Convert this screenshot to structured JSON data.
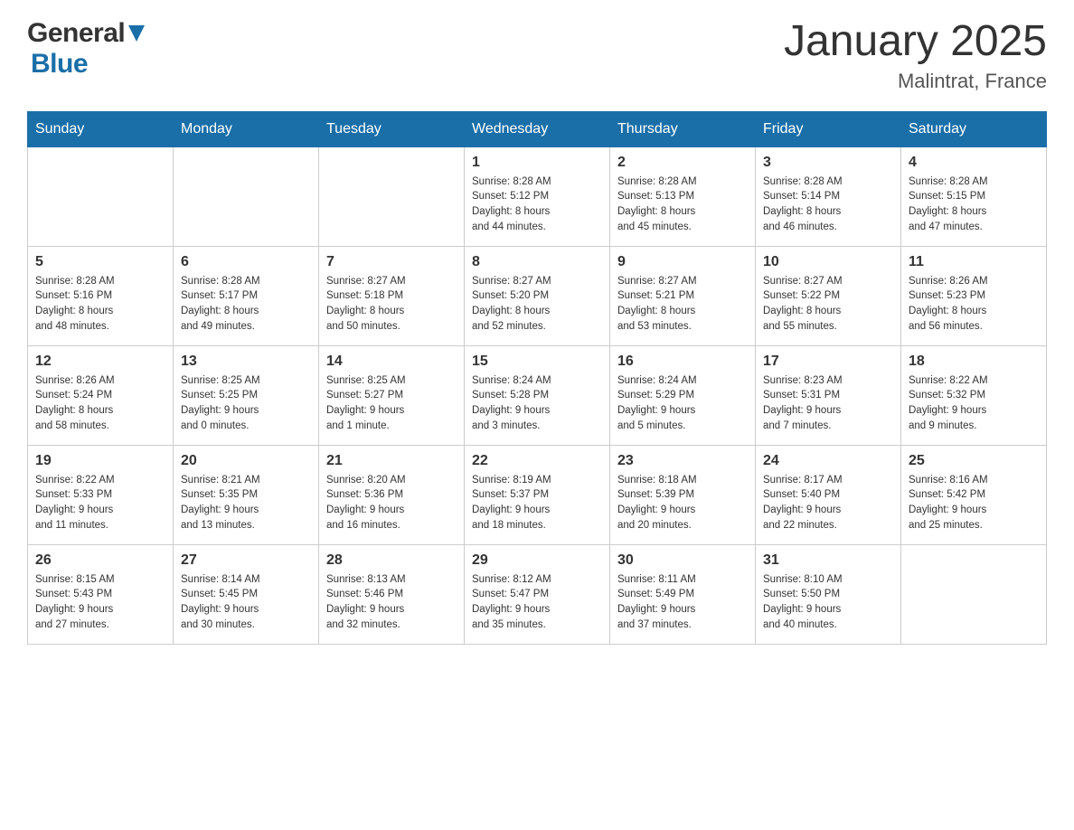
{
  "header": {
    "logo_general": "General",
    "logo_blue": "Blue",
    "title": "January 2025",
    "subtitle": "Malintrat, France"
  },
  "days_of_week": [
    "Sunday",
    "Monday",
    "Tuesday",
    "Wednesday",
    "Thursday",
    "Friday",
    "Saturday"
  ],
  "weeks": [
    [
      {
        "day": "",
        "info": ""
      },
      {
        "day": "",
        "info": ""
      },
      {
        "day": "",
        "info": ""
      },
      {
        "day": "1",
        "info": "Sunrise: 8:28 AM\nSunset: 5:12 PM\nDaylight: 8 hours\nand 44 minutes."
      },
      {
        "day": "2",
        "info": "Sunrise: 8:28 AM\nSunset: 5:13 PM\nDaylight: 8 hours\nand 45 minutes."
      },
      {
        "day": "3",
        "info": "Sunrise: 8:28 AM\nSunset: 5:14 PM\nDaylight: 8 hours\nand 46 minutes."
      },
      {
        "day": "4",
        "info": "Sunrise: 8:28 AM\nSunset: 5:15 PM\nDaylight: 8 hours\nand 47 minutes."
      }
    ],
    [
      {
        "day": "5",
        "info": "Sunrise: 8:28 AM\nSunset: 5:16 PM\nDaylight: 8 hours\nand 48 minutes."
      },
      {
        "day": "6",
        "info": "Sunrise: 8:28 AM\nSunset: 5:17 PM\nDaylight: 8 hours\nand 49 minutes."
      },
      {
        "day": "7",
        "info": "Sunrise: 8:27 AM\nSunset: 5:18 PM\nDaylight: 8 hours\nand 50 minutes."
      },
      {
        "day": "8",
        "info": "Sunrise: 8:27 AM\nSunset: 5:20 PM\nDaylight: 8 hours\nand 52 minutes."
      },
      {
        "day": "9",
        "info": "Sunrise: 8:27 AM\nSunset: 5:21 PM\nDaylight: 8 hours\nand 53 minutes."
      },
      {
        "day": "10",
        "info": "Sunrise: 8:27 AM\nSunset: 5:22 PM\nDaylight: 8 hours\nand 55 minutes."
      },
      {
        "day": "11",
        "info": "Sunrise: 8:26 AM\nSunset: 5:23 PM\nDaylight: 8 hours\nand 56 minutes."
      }
    ],
    [
      {
        "day": "12",
        "info": "Sunrise: 8:26 AM\nSunset: 5:24 PM\nDaylight: 8 hours\nand 58 minutes."
      },
      {
        "day": "13",
        "info": "Sunrise: 8:25 AM\nSunset: 5:25 PM\nDaylight: 9 hours\nand 0 minutes."
      },
      {
        "day": "14",
        "info": "Sunrise: 8:25 AM\nSunset: 5:27 PM\nDaylight: 9 hours\nand 1 minute."
      },
      {
        "day": "15",
        "info": "Sunrise: 8:24 AM\nSunset: 5:28 PM\nDaylight: 9 hours\nand 3 minutes."
      },
      {
        "day": "16",
        "info": "Sunrise: 8:24 AM\nSunset: 5:29 PM\nDaylight: 9 hours\nand 5 minutes."
      },
      {
        "day": "17",
        "info": "Sunrise: 8:23 AM\nSunset: 5:31 PM\nDaylight: 9 hours\nand 7 minutes."
      },
      {
        "day": "18",
        "info": "Sunrise: 8:22 AM\nSunset: 5:32 PM\nDaylight: 9 hours\nand 9 minutes."
      }
    ],
    [
      {
        "day": "19",
        "info": "Sunrise: 8:22 AM\nSunset: 5:33 PM\nDaylight: 9 hours\nand 11 minutes."
      },
      {
        "day": "20",
        "info": "Sunrise: 8:21 AM\nSunset: 5:35 PM\nDaylight: 9 hours\nand 13 minutes."
      },
      {
        "day": "21",
        "info": "Sunrise: 8:20 AM\nSunset: 5:36 PM\nDaylight: 9 hours\nand 16 minutes."
      },
      {
        "day": "22",
        "info": "Sunrise: 8:19 AM\nSunset: 5:37 PM\nDaylight: 9 hours\nand 18 minutes."
      },
      {
        "day": "23",
        "info": "Sunrise: 8:18 AM\nSunset: 5:39 PM\nDaylight: 9 hours\nand 20 minutes."
      },
      {
        "day": "24",
        "info": "Sunrise: 8:17 AM\nSunset: 5:40 PM\nDaylight: 9 hours\nand 22 minutes."
      },
      {
        "day": "25",
        "info": "Sunrise: 8:16 AM\nSunset: 5:42 PM\nDaylight: 9 hours\nand 25 minutes."
      }
    ],
    [
      {
        "day": "26",
        "info": "Sunrise: 8:15 AM\nSunset: 5:43 PM\nDaylight: 9 hours\nand 27 minutes."
      },
      {
        "day": "27",
        "info": "Sunrise: 8:14 AM\nSunset: 5:45 PM\nDaylight: 9 hours\nand 30 minutes."
      },
      {
        "day": "28",
        "info": "Sunrise: 8:13 AM\nSunset: 5:46 PM\nDaylight: 9 hours\nand 32 minutes."
      },
      {
        "day": "29",
        "info": "Sunrise: 8:12 AM\nSunset: 5:47 PM\nDaylight: 9 hours\nand 35 minutes."
      },
      {
        "day": "30",
        "info": "Sunrise: 8:11 AM\nSunset: 5:49 PM\nDaylight: 9 hours\nand 37 minutes."
      },
      {
        "day": "31",
        "info": "Sunrise: 8:10 AM\nSunset: 5:50 PM\nDaylight: 9 hours\nand 40 minutes."
      },
      {
        "day": "",
        "info": ""
      }
    ]
  ]
}
